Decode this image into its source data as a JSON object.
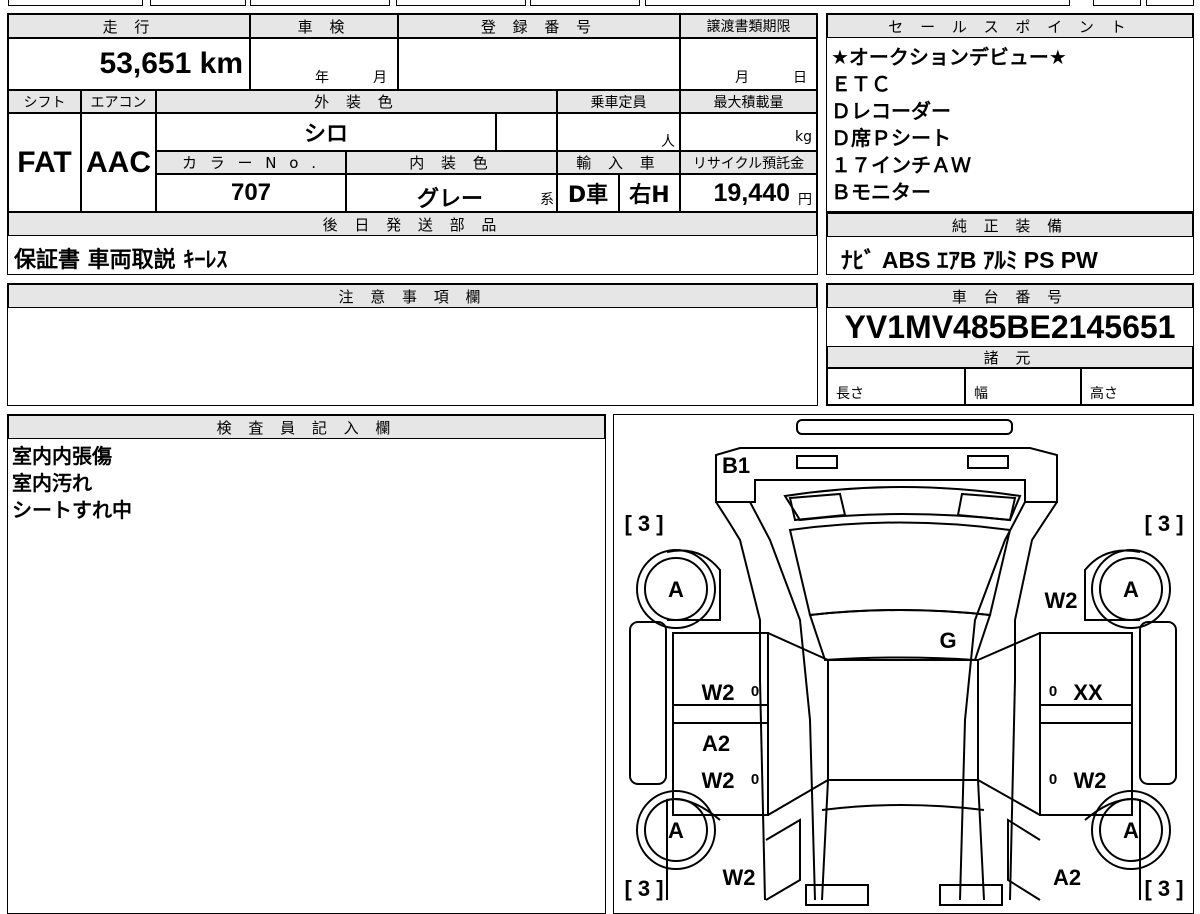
{
  "top": {
    "mileage_header": "走 行",
    "mileage_value": "53,651 km",
    "inspection_header": "車 検",
    "inspection_year": "年",
    "inspection_month": "月",
    "registration_header": "登 録 番 号",
    "registration_value": "",
    "transfer_header": "譲渡書類期限",
    "transfer_month": "月",
    "transfer_day": "日"
  },
  "specs": {
    "shift_header": "シフト",
    "shift_value": "FAT",
    "ac_header": "エアコン",
    "ac_value": "AAC",
    "exterior_header": "外 装 色",
    "exterior_value": "シロ",
    "capacity_header": "乗車定員",
    "capacity_unit": "人",
    "maxload_header": "最大積載量",
    "maxload_unit": "kg",
    "color_no_header": "カ ラ ー N o .",
    "color_no_value": "707",
    "interior_header": "内 装 色",
    "interior_value": "グレー",
    "interior_suffix": "系",
    "import_header": "輸 入 車",
    "import_value1": "D車",
    "import_value2": "右H",
    "recycle_header": "リサイクル預託金",
    "recycle_value": "19,440",
    "recycle_unit": "円"
  },
  "later_parts": {
    "header": "後 日 発 送 部 品",
    "value": "保証書 車両取説 ｷｰﾚｽ"
  },
  "sales_points": {
    "header": "セ ー ル ス ポ イ ン ト",
    "items": [
      "★オークションデビュー★",
      "ＥＴＣ",
      "Ｄレコーダー",
      "Ｄ席Ｐシート",
      "１７インチＡＷ",
      "Ｂモニター"
    ]
  },
  "genuine_equipment": {
    "header": "純 正 装 備",
    "value": "ﾅﾋﾞ ABS ｴｱB ｱﾙﾐ PS PW"
  },
  "notes": {
    "header": "注 意 事 項 欄",
    "value": ""
  },
  "chassis": {
    "header": "車 台 番 号",
    "value": "YV1MV485BE2145651",
    "spec_header": "諸 元",
    "length_label": "長さ",
    "width_label": "幅",
    "height_label": "高さ"
  },
  "inspector": {
    "header": "検 査 員 記 入 欄",
    "lines": [
      "室内内張傷",
      "室内汚れ",
      "シートすれ中"
    ]
  },
  "diagram": {
    "rear_label": "B1",
    "bracket_tl": "[ 3 ]",
    "bracket_tr": "[ 3 ]",
    "bracket_bl": "[ 3 ]",
    "bracket_br": "[ 3 ]",
    "wheel_fl": "A",
    "wheel_fr": "A",
    "wheel_rl": "A",
    "wheel_rr": "A",
    "rear_right_quarter": "W2",
    "rear_glass": "G",
    "left_rear_door": "W2",
    "left_rear_door_zero": "0",
    "right_rear_door_zero": "0",
    "right_rear_door": "XX",
    "left_front_door_1": "A2",
    "left_front_door_2": "W2",
    "left_front_door_zero": "0",
    "right_front_door_zero": "0",
    "right_front_door": "W2",
    "left_fender": "W2",
    "right_fender": "A2"
  }
}
